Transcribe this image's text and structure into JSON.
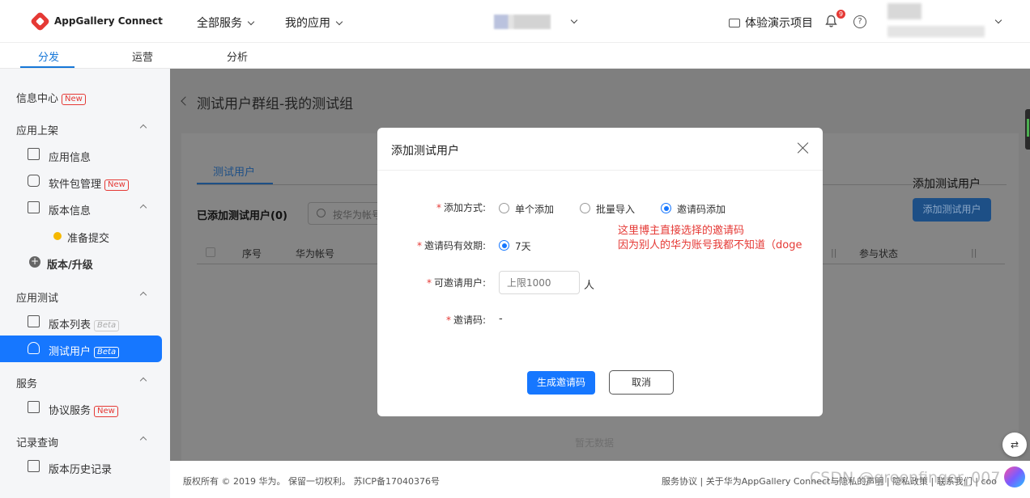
{
  "header": {
    "logo_text": "AppGallery Connect",
    "nav": [
      "全部服务",
      "我的应用"
    ],
    "demo_project": "体验演示项目",
    "notification_count": "9",
    "help_symbol": "?"
  },
  "subnav": {
    "tabs": [
      "分发",
      "运营",
      "分析"
    ],
    "active": "分发"
  },
  "sidebar": {
    "info_center": "信息中心",
    "new_tag": "New",
    "beta_tag": "Beta",
    "sections": {
      "publish": "应用上架",
      "app_info": "应用信息",
      "package_mgmt": "软件包管理",
      "version_info": "版本信息",
      "prepare_submit": "准备提交",
      "version_upgrade": "版本/升级",
      "app_test": "应用测试",
      "version_list": "版本列表",
      "test_users": "测试用户",
      "service": "服务",
      "agreement_service": "协议服务",
      "record_query": "记录查询",
      "version_history": "版本历史记录"
    }
  },
  "main": {
    "page_title": "测试用户群组-我的测试组",
    "tab_test_users": "测试用户",
    "added_count_label": "已添加测试用户(0)",
    "search_placeholder": "按华为帐号",
    "add_label": "添加测试用户",
    "add_button": "添加测试用户",
    "table_headers": [
      "序号",
      "华为帐号",
      "参与状态"
    ],
    "no_data": "暂无数据"
  },
  "modal": {
    "title": "添加测试用户",
    "add_method_label": "添加方式:",
    "add_methods": [
      "单个添加",
      "批量导入",
      "邀请码添加"
    ],
    "selected_method": "邀请码添加",
    "validity_label": "邀请码有效期:",
    "validity_option": "7天",
    "invitable_label": "可邀请用户:",
    "invitable_placeholder": "上限1000",
    "invitable_unit": "人",
    "code_label": "邀请码:",
    "code_value": "-",
    "annotation_line1": "这里博主直接选择的邀请码",
    "annotation_line2": "因为别人的华为账号我都不知道（doge",
    "generate_button": "生成邀请码",
    "cancel_button": "取消"
  },
  "footer": {
    "copyright": "版权所有 © 2019 华为。 保留一切权利。 苏ICP备17040376号",
    "links": "服务协议 | 关于华为AppGallery Connect与隐私的声明 | 隐私政策 | 联系我们 | coo",
    "watermark": "CSDN @greenfinger_007"
  },
  "colors": {
    "primary": "#1677ff",
    "danger": "#e53935",
    "overlay": "#7f7f7f"
  }
}
